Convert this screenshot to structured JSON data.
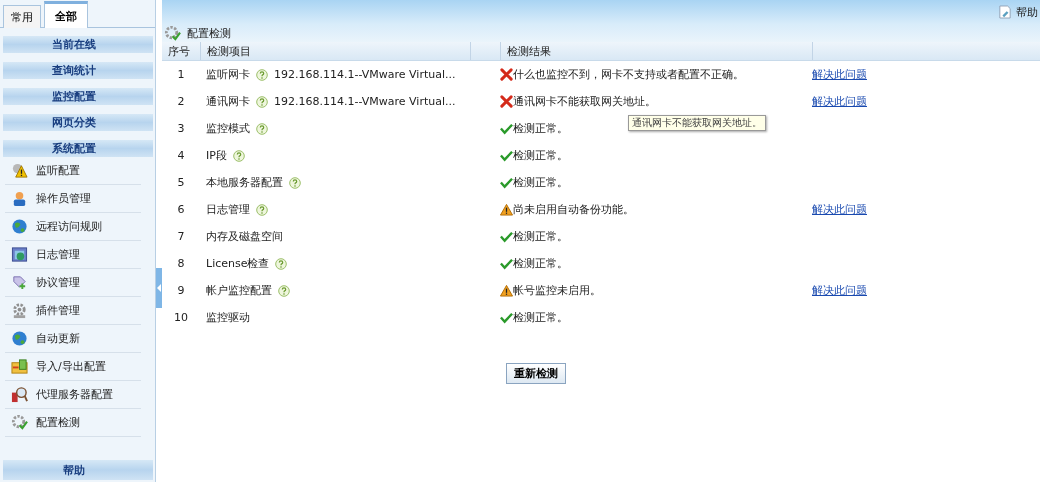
{
  "sidebar": {
    "tabs": [
      {
        "label": "常用",
        "selected": false
      },
      {
        "label": "全部",
        "selected": true
      }
    ],
    "sections": [
      "当前在线",
      "查询统计",
      "监控配置",
      "网页分类",
      "系统配置"
    ],
    "items": [
      {
        "label": "监听配置"
      },
      {
        "label": "操作员管理"
      },
      {
        "label": "远程访问规则"
      },
      {
        "label": "日志管理"
      },
      {
        "label": "协议管理"
      },
      {
        "label": "插件管理"
      },
      {
        "label": "自动更新"
      },
      {
        "label": "导入/导出配置"
      },
      {
        "label": "代理服务器配置"
      },
      {
        "label": "配置检测"
      }
    ],
    "footer": "帮助"
  },
  "header": {
    "help": "帮助"
  },
  "panel": {
    "title": "配置检测",
    "columns": [
      "序号",
      "检测项目",
      "检测结果"
    ],
    "rows": [
      {
        "no": "1",
        "item": "监听网卡",
        "help": true,
        "detail": "192.168.114.1--VMware Virtual...",
        "kind": "error",
        "result": "什么也监控不到，网卡不支持或者配置不正确。",
        "link": "解决此问题"
      },
      {
        "no": "2",
        "item": "通讯网卡",
        "help": true,
        "detail": "192.168.114.1--VMware Virtual...",
        "kind": "error",
        "result": "通讯网卡不能获取网关地址。",
        "link": "解决此问题",
        "tooltip": "通讯网卡不能获取网关地址。"
      },
      {
        "no": "3",
        "item": "监控模式",
        "help": true,
        "kind": "ok",
        "result": "检测正常。"
      },
      {
        "no": "4",
        "item": "IP段",
        "help": true,
        "kind": "ok",
        "result": "检测正常。"
      },
      {
        "no": "5",
        "item": "本地服务器配置",
        "help": true,
        "kind": "ok",
        "result": "检测正常。"
      },
      {
        "no": "6",
        "item": "日志管理",
        "help": true,
        "kind": "warning",
        "result": "尚未启用自动备份功能。",
        "link": "解决此问题"
      },
      {
        "no": "7",
        "item": "内存及磁盘空间",
        "help": false,
        "kind": "ok",
        "result": "检测正常。"
      },
      {
        "no": "8",
        "item": "License检查",
        "help": true,
        "kind": "ok",
        "result": "检测正常。"
      },
      {
        "no": "9",
        "item": "帐户监控配置",
        "help": true,
        "kind": "warning",
        "result": "帐号监控未启用。",
        "link": "解决此问题"
      },
      {
        "no": "10",
        "item": "监控驱动",
        "help": false,
        "kind": "ok",
        "result": "检测正常。"
      }
    ],
    "button": "重新检测"
  }
}
